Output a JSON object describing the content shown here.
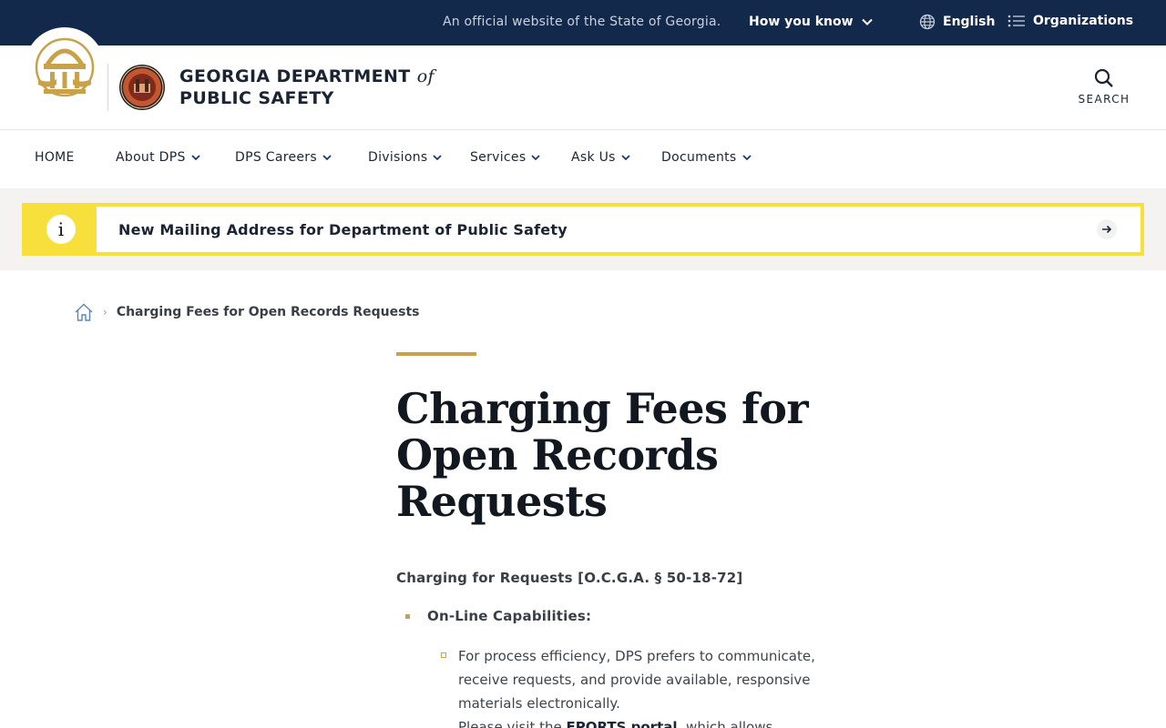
{
  "topbar": {
    "official_text": "An official website of the State of Georgia.",
    "how_you_know": "How you know",
    "language": "English",
    "organizations": "Organizations"
  },
  "header": {
    "org_line1": "GEORGIA DEPARTMENT",
    "org_of": "of",
    "org_line2": "PUBLIC SAFETY",
    "search_label": "SEARCH"
  },
  "nav": {
    "items": [
      {
        "label": "HOME"
      },
      {
        "label": "About DPS"
      },
      {
        "label": "DPS Careers"
      },
      {
        "label": "Divisions"
      },
      {
        "label": "Services"
      },
      {
        "label": "Ask Us"
      },
      {
        "label": "Documents"
      }
    ]
  },
  "alert": {
    "message": "New Mailing Address for Department of Public Safety",
    "icon_glyph": "i"
  },
  "breadcrumb": {
    "current": "Charging Fees for Open Records Requests"
  },
  "main": {
    "title": "Charging Fees for Open Records Requests",
    "intro": "Charging for Requests [O.C.G.A. § 50-18-72]",
    "bullet1": "On-Line Capabilities:",
    "sub_bullet1": "For process efficiency, DPS prefers to communicate, receive requests, and provide available, responsive materials electronically.",
    "sub_bullet2_prefix": "Please visit the ",
    "sub_bullet2_link": "EPORTS portal",
    "sub_bullet2_suffix": ", which allows"
  },
  "colors": {
    "topbar_bg": "#13294b",
    "accent_gold": "#c8a24a",
    "alert_yellow": "#f7e03c"
  }
}
